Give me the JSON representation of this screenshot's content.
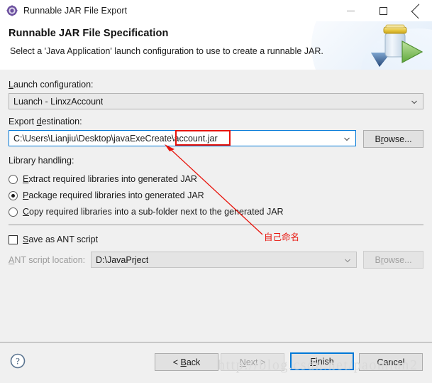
{
  "window": {
    "title": "Runnable JAR File Export",
    "icon": "eclipse-export-icon",
    "controls": {
      "minimize": "—",
      "maximize": "□",
      "close": "✕"
    }
  },
  "banner": {
    "title": "Runnable JAR File Specification",
    "subtitle": "Select a 'Java Application' launch configuration to use to create a runnable JAR.",
    "icon": "jar-export-icon"
  },
  "form": {
    "launch_configuration": {
      "label": "Launch configuration:",
      "value": "Luanch - LinxzAccount"
    },
    "export_destination": {
      "label": "Export destination:",
      "value": "C:\\Users\\Lianjiu\\Desktop\\javaExeCreate\\account.jar",
      "browse_label": "Browse..."
    },
    "library_handling": {
      "label": "Library handling:",
      "options": [
        {
          "label": "Extract required libraries into generated JAR",
          "selected": false
        },
        {
          "label": "Package required libraries into generated JAR",
          "selected": true
        },
        {
          "label": "Copy required libraries into a sub-folder next to the generated JAR",
          "selected": false
        }
      ]
    },
    "save_as_ant": {
      "label": "Save as ANT script",
      "checked": false
    },
    "ant_script_location": {
      "label": "ANT script location:",
      "value": "D:\\JavaPrject",
      "browse_label": "Browse...",
      "enabled": false
    }
  },
  "footer": {
    "help_icon": "help-question-icon",
    "buttons": [
      {
        "name": "back",
        "label": "< Back",
        "state": "enabled"
      },
      {
        "name": "next",
        "label": "Next >",
        "state": "disabled"
      },
      {
        "name": "finish",
        "label": "Finish",
        "state": "default"
      },
      {
        "name": "cancel",
        "label": "Cancel",
        "state": "enabled"
      }
    ]
  },
  "annotations": {
    "highlight_target": "account.jar",
    "note_text": "自己命名",
    "color": "#e8140c"
  },
  "watermark": {
    "text": "http://blog.csdn.net/paomian2"
  }
}
